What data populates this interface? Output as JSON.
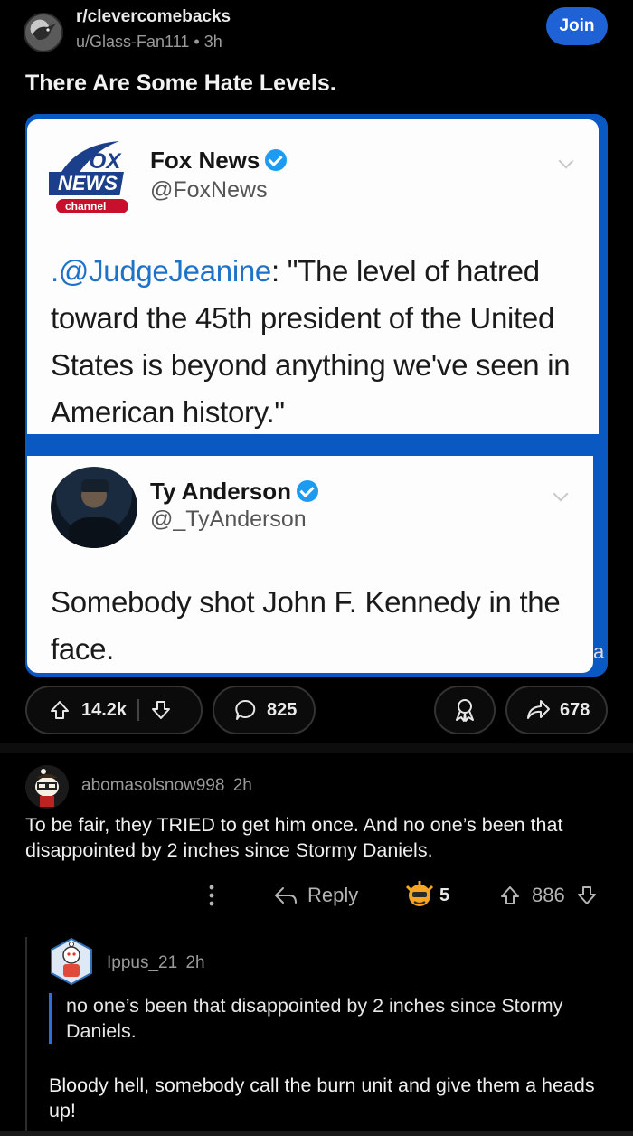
{
  "post": {
    "subreddit": "r/clevercomebacks",
    "author": "u/Glass-Fan111",
    "time": "3h",
    "join_label": "Join",
    "title": "There Are Some Hate Levels.",
    "votes": "14.2k",
    "comments": "825",
    "shares": "678"
  },
  "image": {
    "tweet1": {
      "logo_text": "FOX NEWS channel",
      "name": "Fox News",
      "handle": "@FoxNews",
      "mention": ".@JudgeJeanine",
      "body": ": \"The level of hatred toward the 45th president of the United States is beyond anything we've seen in American history.\""
    },
    "tweet2": {
      "name": "Ty Anderson",
      "handle": "@_TyAnderson",
      "body": "Somebody shot John F. Kennedy in the face."
    },
    "edge_char": "a"
  },
  "comment": {
    "author": "abomasolsnow998",
    "time": "2h",
    "text": "To be fair, they TRIED to get him once. And no one’s been that disappointed by 2 inches since Stormy Daniels.",
    "reply_label": "Reply",
    "award_count": "5",
    "votes": "886"
  },
  "reply": {
    "author": "Ippus_21",
    "time": "2h",
    "quote": "no one’s been that disappointed by 2 inches since Stormy Daniels.",
    "text": "Bloody hell, somebody call the burn unit and give them a heads up!"
  },
  "colors": {
    "accent": "#1e62d6",
    "background": "#000000",
    "quote_bar": "#2e6fd8",
    "twitter_blue": "#1d9bf0",
    "mention": "#1d72c9"
  }
}
